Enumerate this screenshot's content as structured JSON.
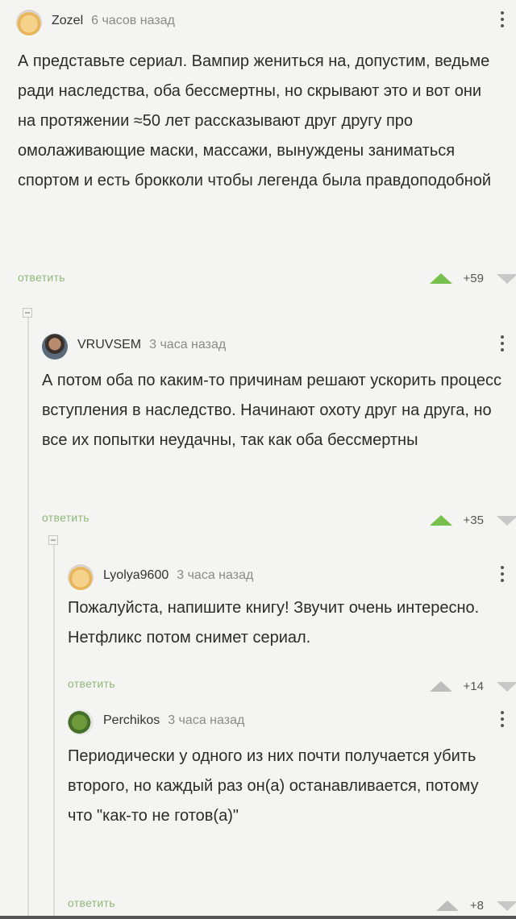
{
  "comments": [
    {
      "author": "Zozel",
      "time": "6 часов назад",
      "text": "А представьте сериал. Вампир жениться на, допустим, ведьме ради наследства, оба бессмертны, но скрывают это и вот они на протяжении ≈50 лет рассказывают друг другу про омолаживающие маски, массажи, вынуждены заниматься спортом и есть брокколи чтобы легенда была правдоподобной",
      "reply_label": "ответить",
      "score": "+59"
    },
    {
      "author": "VRUVSEM",
      "time": "3 часа назад",
      "text": "А потом оба по каким-то причинам решают ускорить процесс вступления в наследство. Начинают охоту друг на друга, но все их попытки неудачны, так как оба бессмертны",
      "reply_label": "ответить",
      "score": "+35"
    },
    {
      "author": "Lyolya9600",
      "time": "3 часа назад",
      "text": "Пожалуйста, напишите книгу! Звучит очень интересно. Нетфликс потом снимет сериал.",
      "reply_label": "ответить",
      "score": "+14"
    },
    {
      "author": "Perchikos",
      "time": "3 часа назад",
      "text": "Периодически у одного из них почти получается убить второго, но каждый раз он(а) останавливается, потому что \"как-то не готов(а)\"",
      "reply_label": "ответить",
      "score": "+8"
    }
  ],
  "colors": {
    "reply": "#8fb97a",
    "upvote_active": "#78c04e",
    "upvote_inactive": "#bdbdbd",
    "downvote": "#c8c8c8"
  },
  "icons": {
    "more": "more-vertical-icon",
    "upvote": "arrow-up-icon",
    "downvote": "arrow-down-icon",
    "collapse": "collapse-thread-icon"
  }
}
